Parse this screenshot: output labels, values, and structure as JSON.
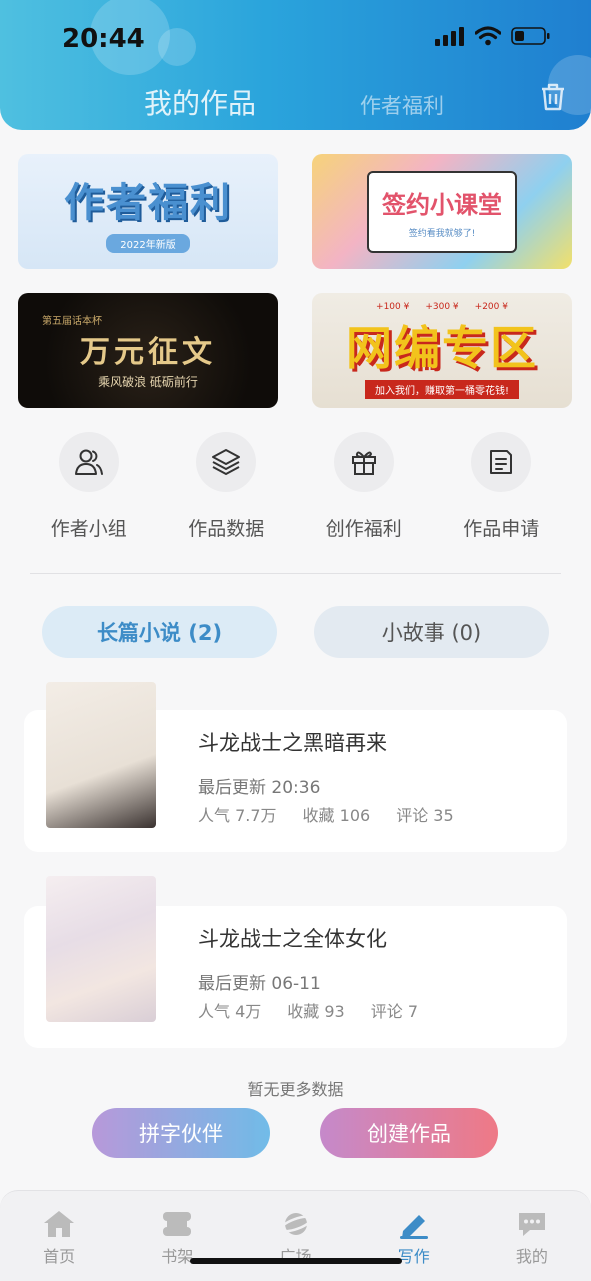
{
  "status_bar": {
    "time": "20:44"
  },
  "header": {
    "title": "我的作品",
    "secondary_tab": "作者福利"
  },
  "banners": {
    "author_benefits": {
      "title": "作者福利",
      "subtitle": "2022年新版"
    },
    "contract_class": {
      "title": "签约小课堂",
      "subtitle": "签约看我就够了!"
    },
    "contest": {
      "small": "第五届话本杯",
      "title": "万元征文",
      "subtitle": "乘风破浪 砥砺前行"
    },
    "web_editor": {
      "title": "网编专区",
      "subtitle": "加入我们，赚取第一桶零花钱!",
      "tags": [
        "+100 ¥",
        "+300 ¥",
        "+200 ¥"
      ]
    }
  },
  "quick_actions": [
    {
      "label": "作者小组",
      "icon": "users-icon"
    },
    {
      "label": "作品数据",
      "icon": "layers-icon"
    },
    {
      "label": "创作福利",
      "icon": "gift-icon"
    },
    {
      "label": "作品申请",
      "icon": "document-icon"
    }
  ],
  "work_tabs": {
    "long_novel": "长篇小说 (2)",
    "short_story": "小故事 (0)"
  },
  "works": [
    {
      "title": "斗龙战士之黑暗再来",
      "updated": "最后更新 20:36",
      "popularity": "人气 7.7万",
      "favorites": "收藏 106",
      "comments": "评论 35"
    },
    {
      "title": "斗龙战士之全体女化",
      "updated": "最后更新 06-11",
      "popularity": "人气 4万",
      "favorites": "收藏 93",
      "comments": "评论 7"
    }
  ],
  "footer": {
    "no_more": "暂无更多数据",
    "partner_button": "拼字伙伴",
    "create_button": "创建作品"
  },
  "tab_bar": [
    {
      "label": "首页",
      "icon": "home-icon"
    },
    {
      "label": "书架",
      "icon": "bookshelf-icon"
    },
    {
      "label": "广场",
      "icon": "planet-icon"
    },
    {
      "label": "写作",
      "icon": "pen-icon",
      "active": true
    },
    {
      "label": "我的",
      "icon": "chat-bubble-icon"
    }
  ],
  "colors": {
    "accent": "#3d8cc7",
    "header_start": "#4fc0e0",
    "header_end": "#1f7fd0"
  }
}
